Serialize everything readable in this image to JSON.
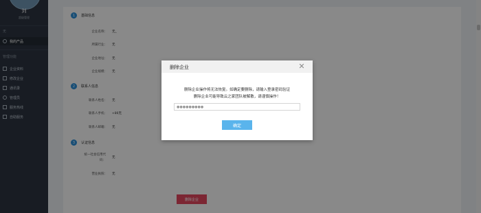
{
  "sidebar": {
    "user_name": "刘",
    "user_role": "超级管理",
    "section_none": "无",
    "active_item": "我的产品",
    "section_manage": "管理功能",
    "items": [
      {
        "label": "企业资料",
        "icon": "document-icon"
      },
      {
        "label": "修改企业",
        "icon": "layers-icon"
      },
      {
        "label": "通讯录",
        "icon": "contacts-icon"
      },
      {
        "label": "管理员",
        "icon": "admin-icon"
      },
      {
        "label": "服务热线",
        "icon": "phone-icon"
      },
      {
        "label": "自助服务",
        "icon": "service-icon"
      }
    ]
  },
  "main": {
    "sections": [
      {
        "num": "1",
        "title": "基础信息",
        "rows": [
          {
            "label": "企业名称：",
            "value": "无_"
          },
          {
            "label": "所属行业：",
            "value": "无"
          },
          {
            "label": "企业地址：",
            "value": "无"
          },
          {
            "label": "企业规模：",
            "value": "无"
          }
        ]
      },
      {
        "num": "2",
        "title": "联系人信息",
        "rows": [
          {
            "label": "联系人姓名：",
            "value": "无"
          },
          {
            "label": "联系人手机：",
            "value": "+86无"
          },
          {
            "label": "联系人邮箱：",
            "value": "无"
          }
        ]
      },
      {
        "num": "3",
        "title": "认证信息",
        "rows": [
          {
            "label": "统一社会信用代码：",
            "value": "无"
          },
          {
            "label": "营业执照：",
            "value": "无"
          }
        ]
      }
    ],
    "delete_button": "删除企业"
  },
  "dialog": {
    "title": "删除企业",
    "message_line1": "删除企业操作将无法恢复。如确定要删除，请输入登录密码验证",
    "message_line2": "删除企业可能导致云之家团队被解散，请谨慎操作！",
    "password_value": "●●●●●●●●●",
    "confirm_label": "确定"
  },
  "colors": {
    "accent": "#2c8fd8",
    "danger": "#e2455d",
    "confirm": "#5ab4ec"
  }
}
